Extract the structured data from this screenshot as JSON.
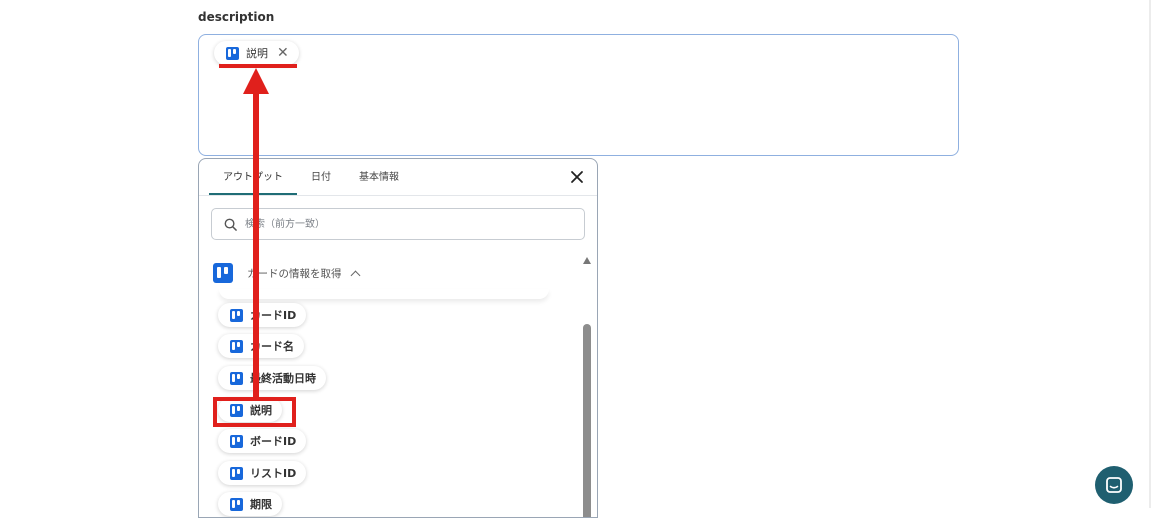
{
  "field": {
    "label": "description",
    "token": {
      "label": "説明",
      "icon": "trello-icon",
      "close_icon": "close-icon"
    }
  },
  "picker": {
    "tabs": [
      {
        "label": "アウトプット",
        "active": true
      },
      {
        "label": "日付",
        "active": false
      },
      {
        "label": "基本情報",
        "active": false
      }
    ],
    "search": {
      "placeholder": "検索（前方一致）",
      "value": ""
    },
    "group": {
      "label": "カードの情報を取得",
      "icon": "trello-icon",
      "expanded": true
    },
    "items": [
      {
        "label": "カードID"
      },
      {
        "label": "カード名"
      },
      {
        "label": "最終活動日時"
      },
      {
        "label": "説明",
        "highlighted": true
      },
      {
        "label": "ボードID"
      },
      {
        "label": "リストID"
      },
      {
        "label": "期限"
      }
    ]
  },
  "annotation": {
    "color": "#e0201c"
  },
  "colors": {
    "accent": "#1f6d76",
    "trello": "#1868db",
    "chat": "#1f5f70"
  }
}
